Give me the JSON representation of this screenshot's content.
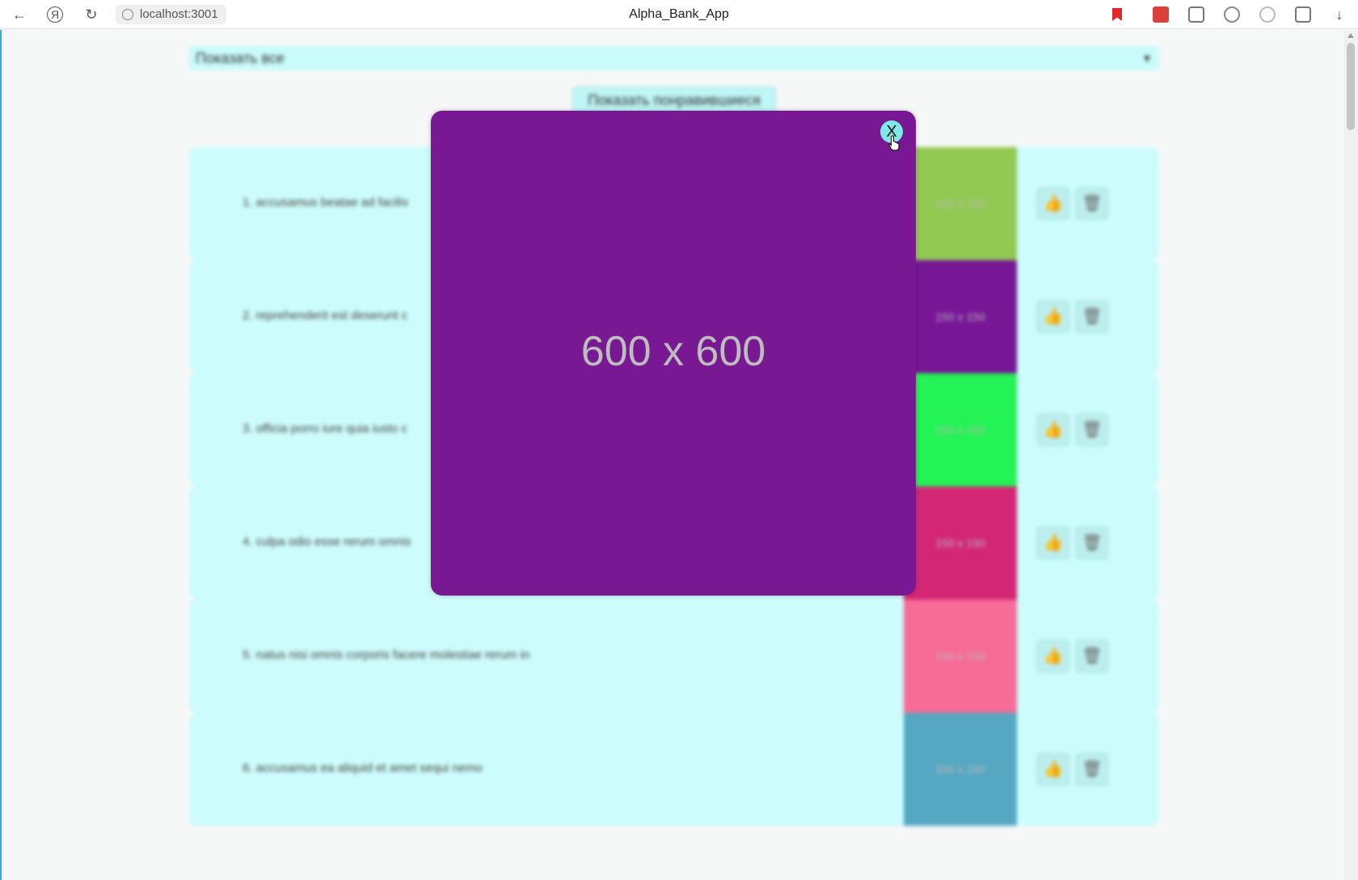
{
  "browser": {
    "url": "localhost:3001",
    "window_title": "Alpha_Bank_App"
  },
  "toolbar": {
    "filter_select_value": "Показать все",
    "show_liked_label": "Показать понравившиеся"
  },
  "cards": [
    {
      "title": "1. accusamus beatae ad facilis",
      "thumb_label": "150 x 150",
      "thumb_color": "#92c952"
    },
    {
      "title": "2. reprehenderit est deserunt c",
      "thumb_label": "150 x 150",
      "thumb_color": "#771796"
    },
    {
      "title": "3. officia porro iure quia iusto c",
      "thumb_label": "150 x 150",
      "thumb_color": "#24f355"
    },
    {
      "title": "4. culpa odio esse rerum omnis",
      "thumb_label": "150 x 150",
      "thumb_color": "#d32776"
    },
    {
      "title": "5. natus nisi omnis corporis facere molestiae rerum in",
      "thumb_label": "150 x 150",
      "thumb_color": "#f66b97"
    },
    {
      "title": "6. accusamus ea aliquid et amet sequi nemo",
      "thumb_label": "150 x 150",
      "thumb_color": "#56a8c2"
    }
  ],
  "modal": {
    "image_label": "600 x 600",
    "image_color": "#791893",
    "close_label": "X"
  }
}
